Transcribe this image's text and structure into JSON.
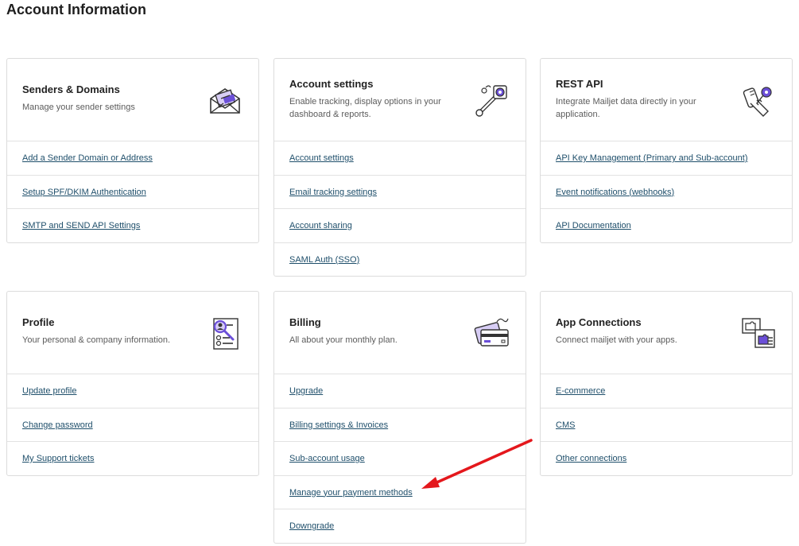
{
  "page": {
    "title": "Account Information"
  },
  "cards": [
    {
      "title": "Senders & Domains",
      "desc": "Manage your sender settings",
      "icon": "envelope-icon",
      "links": [
        "Add a Sender Domain or Address",
        "Setup SPF/DKIM Authentication",
        "SMTP and SEND API Settings"
      ]
    },
    {
      "title": "Account settings",
      "desc": "Enable tracking, display options in your dashboard & reports.",
      "icon": "wrench-gear-icon",
      "links": [
        "Account settings",
        "Email tracking settings",
        "Account sharing",
        "SAML Auth (SSO)"
      ]
    },
    {
      "title": "REST API",
      "desc": "Integrate Mailjet data directly in your application.",
      "icon": "keys-icon",
      "links": [
        "API Key Management (Primary and Sub-account)",
        "Event notifications (webhooks)",
        "API Documentation"
      ]
    },
    {
      "title": "Profile",
      "desc": "Your personal & company information.",
      "icon": "profile-card-icon",
      "links": [
        "Update profile",
        "Change password",
        "My Support tickets"
      ]
    },
    {
      "title": "Billing",
      "desc": "All about your monthly plan.",
      "icon": "credit-card-icon",
      "links": [
        "Upgrade",
        "Billing settings & Invoices",
        "Sub-account usage",
        "Manage your payment methods",
        "Downgrade"
      ]
    },
    {
      "title": "App Connections",
      "desc": "Connect mailjet with your apps.",
      "icon": "puzzle-apps-icon",
      "links": [
        "E-commerce",
        "CMS",
        "Other connections"
      ]
    }
  ],
  "colors": {
    "accent_purple": "#6b4fd8",
    "link": "#1f4f6b",
    "annotation_arrow": "#e4171c"
  }
}
